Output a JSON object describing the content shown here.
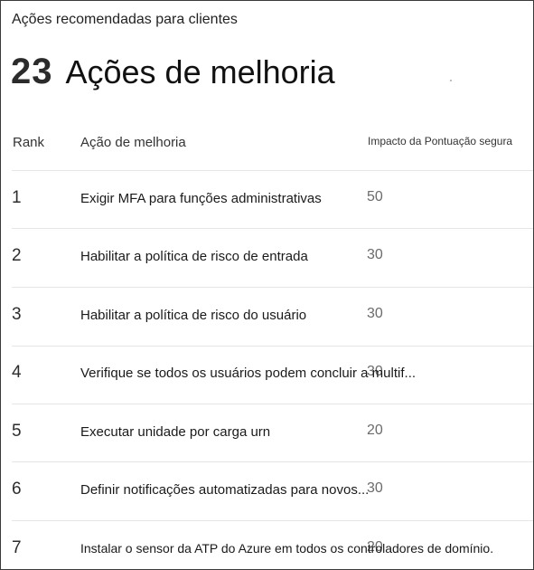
{
  "card": {
    "title": "Ações recomendadas para clientes",
    "count": "23",
    "count_label": "Ações de melhoria"
  },
  "columns": {
    "rank": "Rank",
    "action": "Ação de melhoria",
    "impact": "Impacto da Pontuação segura"
  },
  "rows": [
    {
      "rank": "1",
      "action": "Exigir MFA para funções administrativas",
      "impact": "50"
    },
    {
      "rank": "2",
      "action": "Habilitar a política de risco de entrada",
      "impact": "30"
    },
    {
      "rank": "3",
      "action": "Habilitar a política de risco do usuário",
      "impact": "30"
    },
    {
      "rank": "4",
      "action": "Verifique se todos os usuários podem concluir a multif...",
      "impact": "30"
    },
    {
      "rank": "5",
      "action": "Executar unidade por carga urn",
      "impact": "20"
    },
    {
      "rank": "6",
      "action": "Definir notificações automatizadas para novos...",
      "impact": "30"
    },
    {
      "rank": "7",
      "action": "Instalar o sensor da ATP do Azure em todos os controladores de domínio.",
      "impact": "20"
    }
  ],
  "colors": {
    "border": "#3a3a3a",
    "divider": "#e6e6e6",
    "impact_text": "#6b6b6b"
  }
}
